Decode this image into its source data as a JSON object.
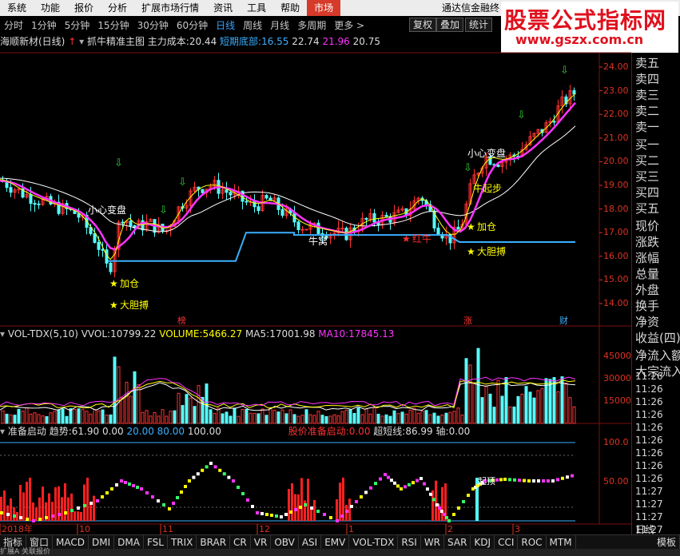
{
  "menu": {
    "items": [
      "系统",
      "功能",
      "报价",
      "分析",
      "扩展市场行情",
      "资讯",
      "工具",
      "帮助"
    ],
    "active": "市场",
    "title": "通达信金融终"
  },
  "watermark": {
    "text": "股票公式指标网",
    "url": "www.gszx.com.cn"
  },
  "periods": [
    "分时",
    "1分钟",
    "5分钟",
    "15分钟",
    "30分钟",
    "60分钟",
    "日线",
    "周线",
    "月线",
    "多周期",
    "更多 >"
  ],
  "active_period": "日线",
  "toolbar_buttons": [
    "复权",
    "叠加",
    "统计"
  ],
  "main_info": {
    "stock": "海顺新材(日线)",
    "indicator": "抓牛精准主图",
    "cost_label": "主力成本:",
    "cost_value": "20.44",
    "bottom_label": "短期底部:",
    "bottom_value": "16.55",
    "v1": "22.74",
    "v2": "21.96",
    "v3": "20.75"
  },
  "price_axis": [
    "24.00",
    "23.00",
    "22.00",
    "21.00",
    "20.00",
    "19.00",
    "18.00",
    "17.00",
    "16.00",
    "15.00",
    "14.00"
  ],
  "annotations": [
    "小心变盘",
    "加仓",
    "大胆搏",
    "牛窝",
    "红牛",
    "加仓",
    "大胆搏",
    "牛起步",
    "小心变盘"
  ],
  "markers": [
    "榜",
    "涨",
    "财"
  ],
  "vol_info": {
    "name": "VOL-TDX(5,10)",
    "vvol_label": "VVOL:",
    "vvol": "10799.22",
    "volume_label": "VOLUME:",
    "volume": "5466.27",
    "ma5_label": "MA5:",
    "ma5": "17001.98",
    "ma10_label": "MA10:",
    "ma10": "17845.13"
  },
  "vol_axis": [
    "45000",
    "30000",
    "15000"
  ],
  "osc_info": {
    "name": "准备启动",
    "trend_label": "趋势:",
    "trend": "61.90",
    "v1": "0.00",
    "v2": "20.00",
    "v3": "80.00",
    "v4": "100.00",
    "ready_label": "股价准备启动:",
    "ready": "0.00",
    "short_label": "超短线:",
    "short": "86.99",
    "axis_label": "轴:",
    "axis": "0.00",
    "tag": "起顶"
  },
  "osc_axis": [
    "100.0",
    "50.00"
  ],
  "date_axis": [
    "2018年",
    "10",
    "11",
    "12",
    "1",
    "2",
    "3"
  ],
  "right_panel": {
    "sell": [
      "卖五",
      "卖四",
      "卖三",
      "卖二",
      "卖一"
    ],
    "buy": [
      "买一",
      "买二",
      "买三",
      "买四",
      "买五"
    ],
    "fields": [
      "现价",
      "涨跌",
      "涨幅",
      "总量",
      "外盘",
      "换手",
      "净资",
      "收益(四)",
      "净流入额",
      "大宗流入"
    ],
    "times": [
      "11:26",
      "11:26",
      "11:26",
      "11:26",
      "11:26",
      "11:26",
      "11:26",
      "11:26",
      "11:26",
      "11:27",
      "11:27",
      "11:27",
      "11:27",
      "11:27",
      "11:29"
    ],
    "bottom_tab": "日线"
  },
  "bottom_tabs": [
    "指标",
    "窗口",
    "MACD",
    "DMI",
    "DMA",
    "FSL",
    "TRIX",
    "BRAR",
    "CR",
    "VR",
    "OBV",
    "ASI",
    "EMV",
    "VOL-TDX",
    "RSI",
    "WR",
    "SAR",
    "KDJ",
    "CCI",
    "ROC",
    "MTM"
  ],
  "bottom_tab_extra": "模板",
  "status": "扩展A 关联报价",
  "colors": {
    "up": "#ff3232",
    "down": "#54ffff",
    "ma_white": "#ffffff",
    "ma_yellow": "#ffff00",
    "ma_magenta": "#ff33ff",
    "cost_line": "#3ab0ff",
    "accent": "#d63a2a"
  }
}
